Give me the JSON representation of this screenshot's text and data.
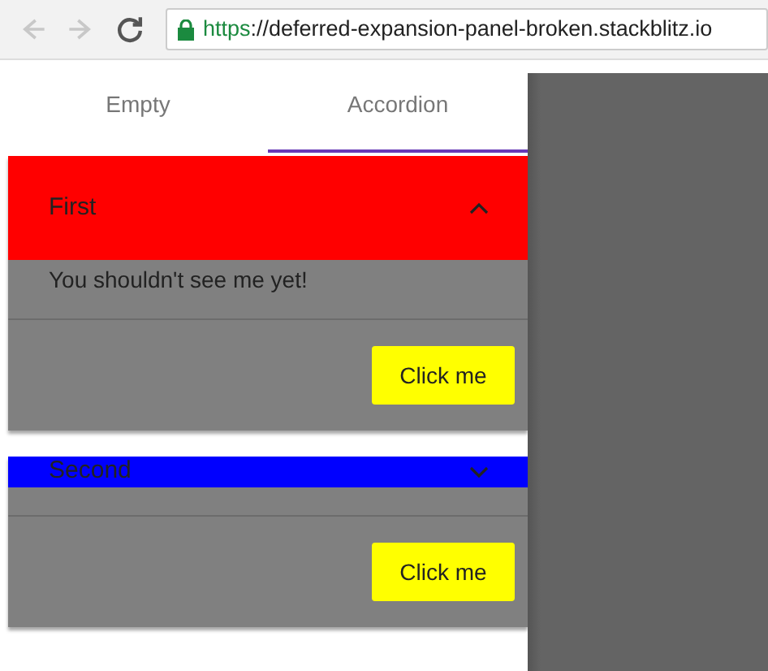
{
  "browser": {
    "nav_buttons": [
      {
        "kind": "back",
        "disabled": true
      },
      {
        "kind": "forward",
        "disabled": true
      },
      {
        "kind": "reload",
        "disabled": false
      }
    ],
    "secure": true,
    "url_scheme": "https",
    "url_rest": "://deferred-expansion-panel-broken.stackblitz.io"
  },
  "tabs": [
    {
      "label": "Empty",
      "selected": false
    },
    {
      "label": "Accordion",
      "selected": true
    }
  ],
  "panels": [
    {
      "title": "First",
      "expanded": true,
      "color": "#ff0000",
      "content": "You shouldn't see me yet!",
      "button": "Click me"
    },
    {
      "title": "Second",
      "expanded": false,
      "color": "#0000ff",
      "button": "Click me"
    }
  ],
  "overlay": {
    "shown": true
  }
}
